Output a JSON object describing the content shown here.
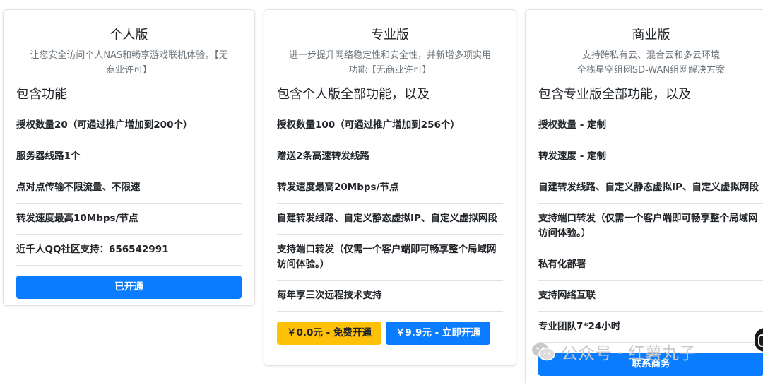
{
  "plans": {
    "personal": {
      "title": "个人版",
      "desc_line1": "让您安全访问个人NAS和畅享游戏联机体验。【无",
      "desc_line2": "商业许可】",
      "features_heading": "包含功能",
      "features": [
        "授权数量20（可通过推广增加到200个）",
        "服务器线路1个",
        "点对点传输不限流量、不限速",
        "转发速度最高10Mbps/节点",
        "近千人QQ社区支持：656542991"
      ],
      "button": "已开通"
    },
    "pro": {
      "title": "专业版",
      "desc_line1": "进一步提升网络稳定性和安全性，并新增多项实用",
      "desc_line2": "功能【无商业许可】",
      "features_heading": "包含个人版全部功能，以及",
      "features": [
        "授权数量100（可通过推广增加到256个）",
        "赠送2条高速转发线路",
        "转发速度最高20Mbps/节点",
        "自建转发线路、自定义静态虚拟IP、自定义虚拟网段",
        "支持端口转发（仅需一个客户端即可畅享整个局域网访问体验。）",
        "每年享三次远程技术支持"
      ],
      "button_free": "￥0.0元 - 免费开通",
      "button_paid": "￥9.9元 - 立即开通"
    },
    "business": {
      "title": "商业版",
      "desc_line1": "支持跨私有云、混合云和多云环境",
      "desc_line2": "全栈星空组网SD-WAN组网解决方案",
      "features_heading": "包含专业版全部功能，以及",
      "features": [
        "授权数量 - 定制",
        "转发速度 - 定制",
        "自建转发线路、自定义静态虚拟IP、自定义虚拟网段",
        "支持端口转发（仅需一个客户端即可畅享整个局域网访问体验。）",
        "私有化部署",
        "支持网络互联",
        "专业团队7*24小时"
      ],
      "button": "联系商务"
    }
  },
  "watermark": {
    "text": "公众号 · 红薯丸子",
    "icon": "wechat-icon"
  },
  "colors": {
    "primary": "#0a7cff",
    "warning": "#ffc107",
    "muted": "#6c757d"
  }
}
